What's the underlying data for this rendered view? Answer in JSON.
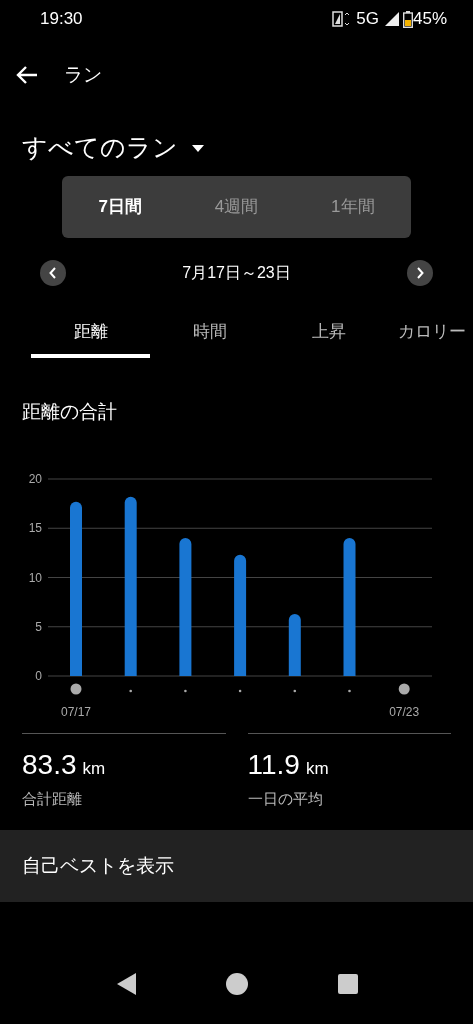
{
  "status_bar": {
    "time": "19:30",
    "network": "5G",
    "battery": "45%"
  },
  "header": {
    "title": "ラン"
  },
  "filter": {
    "label": "すべてのラン"
  },
  "periods": [
    {
      "label": "7日間",
      "selected": true
    },
    {
      "label": "4週間",
      "selected": false
    },
    {
      "label": "1年間",
      "selected": false
    }
  ],
  "date_range": "7月17日～23日",
  "tabs": [
    {
      "label": "距離",
      "selected": true
    },
    {
      "label": "時間",
      "selected": false
    },
    {
      "label": "上昇",
      "selected": false
    },
    {
      "label": "カロリー",
      "selected": false
    }
  ],
  "section_title": "距離の合計",
  "chart_data": {
    "type": "bar",
    "categories": [
      "07/17",
      null,
      null,
      null,
      null,
      null,
      "07/23"
    ],
    "values": [
      17.7,
      18.2,
      14.0,
      12.3,
      6.3,
      14.0,
      null
    ],
    "ylim": [
      0,
      20
    ],
    "yticks": [
      0,
      5,
      10,
      15,
      20
    ],
    "grid": true
  },
  "stats": [
    {
      "value": "83.3",
      "unit": "km",
      "label": "合計距離"
    },
    {
      "value": "11.9",
      "unit": "km",
      "label": "一日の平均"
    }
  ],
  "best_link": "自己ベストを表示"
}
